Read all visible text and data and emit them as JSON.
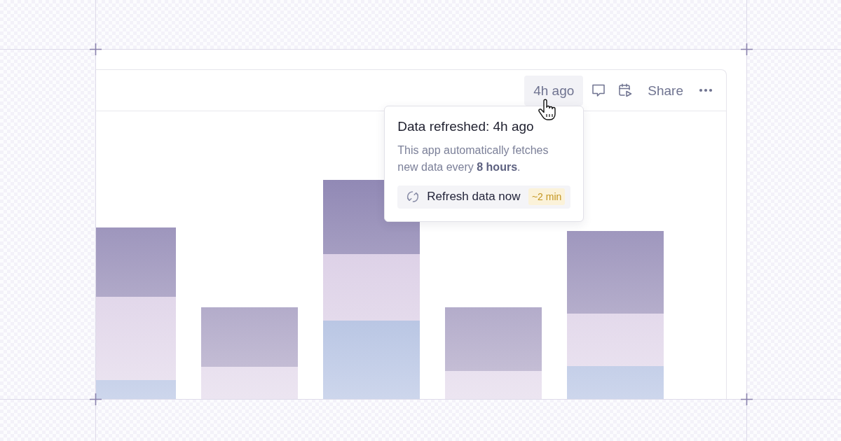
{
  "toolbar": {
    "last_refresh": {
      "label": "4h ago",
      "hovered": true
    },
    "share": "Share"
  },
  "tooltip": {
    "title": "Data refreshed: 4h ago",
    "description": "This app automatically fetches new data every **8 hours**.",
    "action": {
      "label": "Refresh data now",
      "estimate": "~2 min"
    }
  }
}
